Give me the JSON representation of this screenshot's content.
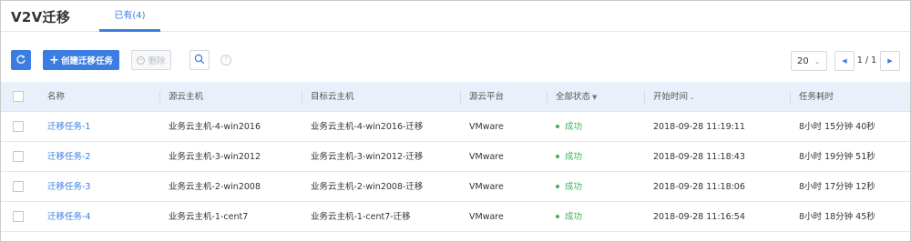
{
  "header": {
    "title": "V2V迁移",
    "tab_label": "已有(4)"
  },
  "toolbar": {
    "refresh_icon": "refresh-icon",
    "create_label": "创建迁移任务",
    "delete_label": "删除",
    "search_icon": "search-icon",
    "help_icon": "help-icon",
    "help_glyph": "?"
  },
  "pagination": {
    "page_size": "20",
    "page_info": "1 / 1"
  },
  "table": {
    "columns": {
      "name": "名称",
      "source": "源云主机",
      "target": "目标云主机",
      "platform": "源云平台",
      "status": "全部状态",
      "start": "开始时间",
      "duration": "任务耗时"
    },
    "rows": [
      {
        "name": "迁移任务-1",
        "source": "业务云主机-4-win2016",
        "target": "业务云主机-4-win2016-迁移",
        "platform": "VMware",
        "status": "成功",
        "start": "2018-09-28 11:19:11",
        "duration": "8小时 15分钟 40秒"
      },
      {
        "name": "迁移任务-2",
        "source": "业务云主机-3-win2012",
        "target": "业务云主机-3-win2012-迁移",
        "platform": "VMware",
        "status": "成功",
        "start": "2018-09-28 11:18:43",
        "duration": "8小时 19分钟 51秒"
      },
      {
        "name": "迁移任务-3",
        "source": "业务云主机-2-win2008",
        "target": "业务云主机-2-win2008-迁移",
        "platform": "VMware",
        "status": "成功",
        "start": "2018-09-28 11:18:06",
        "duration": "8小时 17分钟 12秒"
      },
      {
        "name": "迁移任务-4",
        "source": "业务云主机-1-cent7",
        "target": "业务云主机-1-cent7-迁移",
        "platform": "VMware",
        "status": "成功",
        "start": "2018-09-28 11:16:54",
        "duration": "8小时 18分钟 45秒"
      }
    ]
  },
  "colors": {
    "accent": "#3b7de0",
    "success": "#3fb15a",
    "header_bg": "#e9f0fa"
  }
}
